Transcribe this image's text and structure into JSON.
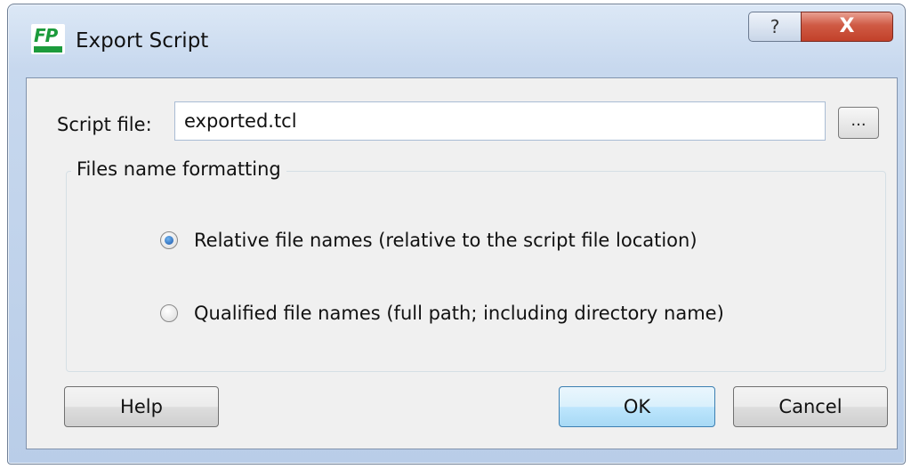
{
  "window": {
    "title": "Export Script",
    "app_icon_text": "FP",
    "help_glyph": "?",
    "close_glyph": "X"
  },
  "script_file": {
    "label": "Script file:",
    "value": "exported.tcl",
    "browse_label": "..."
  },
  "formatting": {
    "group_title": "Files name formatting",
    "options": [
      {
        "label": "Relative file names (relative to the script file location)",
        "checked": true
      },
      {
        "label": "Qualified file names (full path; including directory name)",
        "checked": false
      }
    ]
  },
  "buttons": {
    "help": "Help",
    "ok": "OK",
    "cancel": "Cancel"
  }
}
